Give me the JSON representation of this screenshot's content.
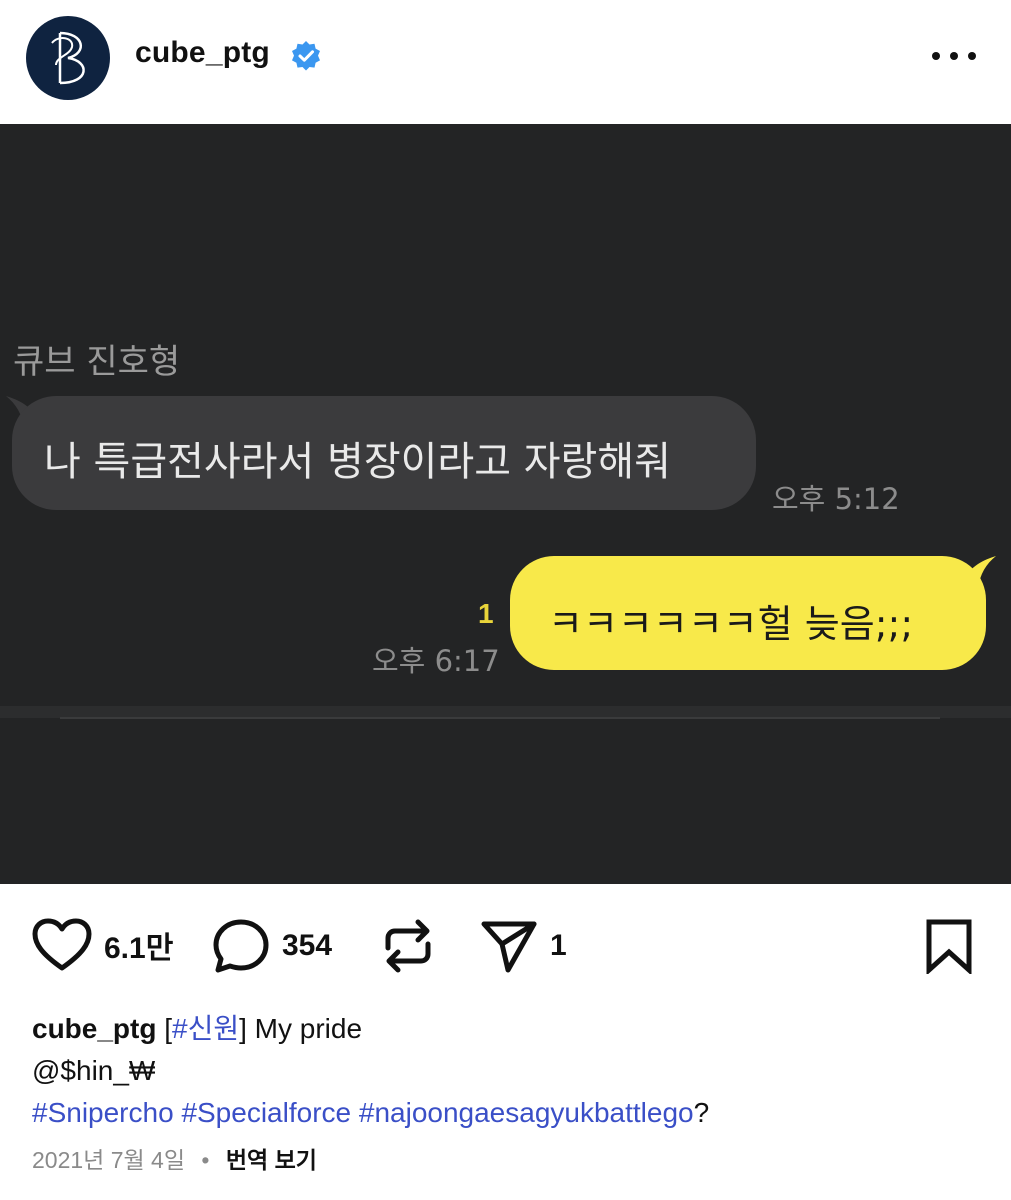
{
  "header": {
    "username": "cube_ptg",
    "verified": true,
    "avatar_icon": "brand-logo-monogram",
    "more_icon": "more-dots-icon"
  },
  "chat": {
    "sender_name": "큐브 진호형",
    "incoming_message": "나 특급전사라서 병장이라고 자랑해줘",
    "incoming_time": "오후 5:12",
    "outgoing_message": "ㅋㅋㅋㅋㅋㅋ헐 늦음;;;",
    "outgoing_unread": "1",
    "outgoing_time": "오후 6:17",
    "colors": {
      "background": "#232425",
      "incoming_bubble": "#3b3b3d",
      "outgoing_bubble": "#f8e94a"
    }
  },
  "actions": {
    "like_count": "6.1만",
    "comment_count": "354",
    "share_count": "1",
    "icons": [
      "heart-icon",
      "comment-icon",
      "repost-icon",
      "send-icon",
      "bookmark-icon"
    ]
  },
  "caption": {
    "username": "cube_ptg",
    "tag_open": "[",
    "tag": "#신원",
    "tag_close": "]",
    "text": " My pride",
    "mention": "@$hin_₩",
    "hashtags": [
      "#Snipercho",
      "#Specialforce",
      "#najoongaesagyukbattlego"
    ],
    "hashtag_suffix": "?",
    "link_color": "#3a4fc7"
  },
  "meta": {
    "date": "2021년 7월 4일",
    "separator": "•",
    "translate_label": "번역 보기"
  }
}
